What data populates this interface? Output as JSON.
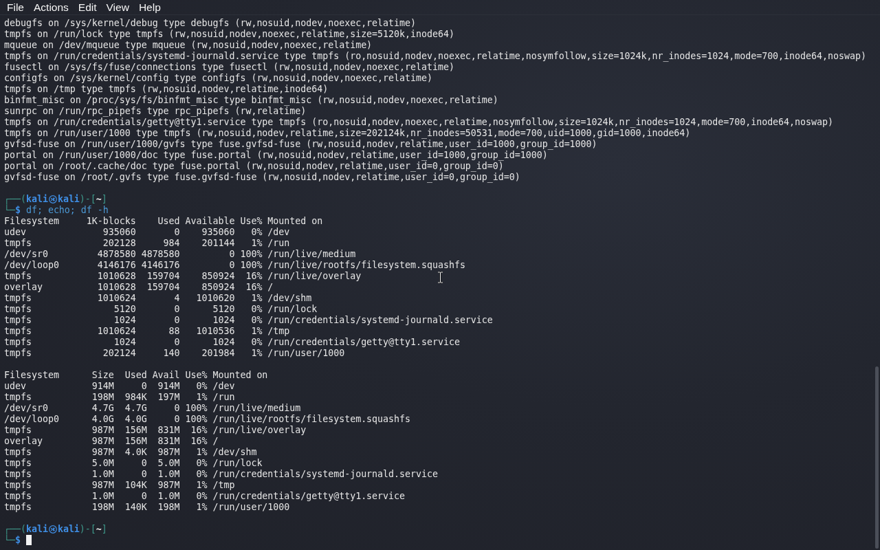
{
  "menu_bar": {
    "items": [
      {
        "label": "File"
      },
      {
        "label": "Actions"
      },
      {
        "label": "Edit"
      },
      {
        "label": "View"
      },
      {
        "label": "Help"
      }
    ]
  },
  "terminal": {
    "session": [
      {
        "kind": "output",
        "lines": [
          "debugfs on /sys/kernel/debug type debugfs (rw,nosuid,nodev,noexec,relatime)",
          "tmpfs on /run/lock type tmpfs (rw,nosuid,nodev,noexec,relatime,size=5120k,inode64)",
          "mqueue on /dev/mqueue type mqueue (rw,nosuid,nodev,noexec,relatime)",
          "tmpfs on /run/credentials/systemd-journald.service type tmpfs (ro,nosuid,nodev,noexec,relatime,nosymfollow,size=1024k,nr_inodes=1024,mode=700,inode64,noswap)",
          "fusectl on /sys/fs/fuse/connections type fusectl (rw,nosuid,nodev,noexec,relatime)",
          "configfs on /sys/kernel/config type configfs (rw,nosuid,nodev,noexec,relatime)",
          "tmpfs on /tmp type tmpfs (rw,nosuid,nodev,relatime,inode64)",
          "binfmt_misc on /proc/sys/fs/binfmt_misc type binfmt_misc (rw,nosuid,nodev,noexec,relatime)",
          "sunrpc on /run/rpc_pipefs type rpc_pipefs (rw,relatime)",
          "tmpfs on /run/credentials/getty@tty1.service type tmpfs (ro,nosuid,nodev,noexec,relatime,nosymfollow,size=1024k,nr_inodes=1024,mode=700,inode64,noswap)",
          "tmpfs on /run/user/1000 type tmpfs (rw,nosuid,nodev,relatime,size=202124k,nr_inodes=50531,mode=700,uid=1000,gid=1000,inode64)",
          "gvfsd-fuse on /run/user/1000/gvfs type fuse.gvfsd-fuse (rw,nosuid,nodev,relatime,user_id=1000,group_id=1000)",
          "portal on /run/user/1000/doc type fuse.portal (rw,nosuid,nodev,relatime,user_id=1000,group_id=1000)",
          "portal on /root/.cache/doc type fuse.portal (rw,nosuid,nodev,relatime,user_id=0,group_id=0)",
          "gvfsd-fuse on /root/.gvfs type fuse.gvfsd-fuse (rw,nosuid,nodev,relatime,user_id=0,group_id=0)"
        ]
      },
      {
        "kind": "prompt",
        "frame_open": "┌──(",
        "user": "kali",
        "host": "kali",
        "frame_mid": ")-[",
        "cwd": "~",
        "frame_close": "]",
        "frame_corner": "└─",
        "symbol": "$",
        "command": "df; echo; df -h",
        "cursor": false
      },
      {
        "kind": "output",
        "lines": [
          "Filesystem     1K-blocks    Used Available Use% Mounted on",
          "udev              935060       0    935060   0% /dev",
          "tmpfs             202128     984    201144   1% /run",
          "/dev/sr0         4878580 4878580         0 100% /run/live/medium",
          "/dev/loop0       4146176 4146176         0 100% /run/live/rootfs/filesystem.squashfs",
          "tmpfs            1010628  159704    850924  16% /run/live/overlay",
          "overlay          1010628  159704    850924  16% /",
          "tmpfs            1010624       4   1010620   1% /dev/shm",
          "tmpfs               5120       0      5120   0% /run/lock",
          "tmpfs               1024       0      1024   0% /run/credentials/systemd-journald.service",
          "tmpfs            1010624      88   1010536   1% /tmp",
          "tmpfs               1024       0      1024   0% /run/credentials/getty@tty1.service",
          "tmpfs             202124     140    201984   1% /run/user/1000"
        ]
      },
      {
        "kind": "output",
        "lines": [
          "Filesystem      Size  Used Avail Use% Mounted on",
          "udev            914M     0  914M   0% /dev",
          "tmpfs           198M  984K  197M   1% /run",
          "/dev/sr0        4.7G  4.7G     0 100% /run/live/medium",
          "/dev/loop0      4.0G  4.0G     0 100% /run/live/rootfs/filesystem.squashfs",
          "tmpfs           987M  156M  831M  16% /run/live/overlay",
          "overlay         987M  156M  831M  16% /",
          "tmpfs           987M  4.0K  987M   1% /dev/shm",
          "tmpfs           5.0M     0  5.0M   0% /run/lock",
          "tmpfs           1.0M     0  1.0M   0% /run/credentials/systemd-journald.service",
          "tmpfs           987M  104K  987M   1% /tmp",
          "tmpfs           1.0M     0  1.0M   0% /run/credentials/getty@tty1.service",
          "tmpfs           198M  140K  198M   1% /run/user/1000"
        ]
      },
      {
        "kind": "prompt",
        "frame_open": "┌──(",
        "user": "kali",
        "host": "kali",
        "frame_mid": ")-[",
        "cwd": "~",
        "frame_close": "]",
        "frame_corner": "└─",
        "symbol": "$",
        "cursor": true
      }
    ]
  }
}
